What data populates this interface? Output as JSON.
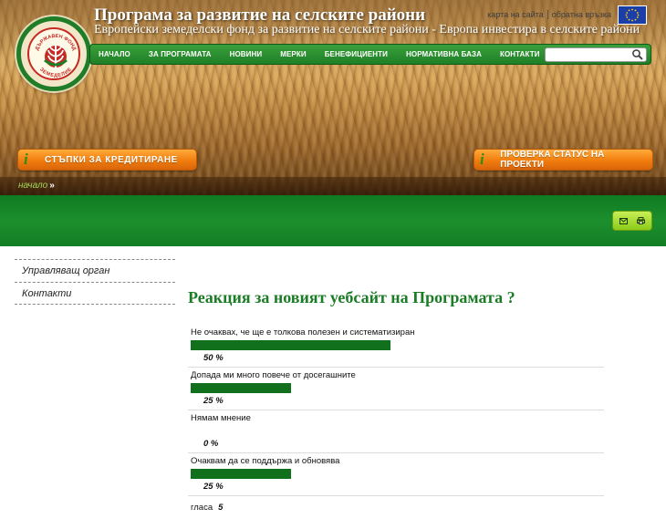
{
  "header": {
    "title": "Програма за развитие на селските райони",
    "subtitle": "Европейски земеделски фонд за развитие на селските райони - Европа инвестира в селските райони",
    "top_links": [
      "карта на сайта",
      "обратна връзка"
    ],
    "logo_top_text": "ДЪРЖАВЕН ФОНД",
    "logo_bottom_text": "ЗЕМЕДЕЛИЕ"
  },
  "nav": {
    "items": [
      "НАЧАЛО",
      "ЗА ПРОГРАМАТА",
      "НОВИНИ",
      "МЕРКИ",
      "БЕНЕФИЦИЕНТИ",
      "НОРМАТИВНА БАЗА",
      "КОНТАКТИ"
    ],
    "search_placeholder": "",
    "search_icon": "search-icon"
  },
  "buttons": {
    "credit": "СТЪПКИ ЗА КРЕДИТИРАНЕ",
    "status": "ПРОВЕРКА СТАТУС НА ПРОЕКТИ",
    "info_glyph": "i"
  },
  "breadcrumb": {
    "home": "начало",
    "arrow": "»"
  },
  "tools": {
    "icons": [
      "mail-icon",
      "print-icon"
    ]
  },
  "sidebar": {
    "items": [
      "Управляващ орган",
      "Контакти"
    ]
  },
  "poll": {
    "title": "Реакция за новият уебсайт на Програмата ?",
    "options": [
      {
        "label": "Не очаквах, че ще е толкова полезен и систематизиран",
        "percent_label": "50 %",
        "percent": 50
      },
      {
        "label": "Допада ми много повече от досегашните",
        "percent_label": "25 %",
        "percent": 25
      },
      {
        "label": "Нямам мнение",
        "percent_label": "0 %",
        "percent": 0
      },
      {
        "label": "Очаквам да се поддържа и обновява",
        "percent_label": "25 %",
        "percent": 25
      }
    ],
    "votes_label": "гласа",
    "votes_count": "5"
  },
  "colors": {
    "brand_green": "#1b7c26",
    "bar_green": "#11701c",
    "orange": "#f17d0e",
    "eu_blue": "#1b3fa6"
  }
}
